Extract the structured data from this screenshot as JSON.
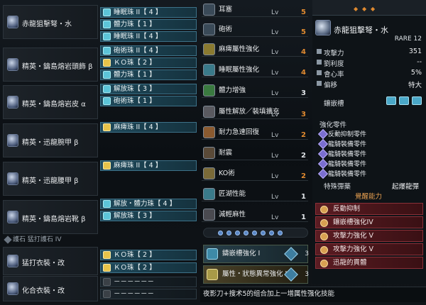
{
  "equipment": [
    {
      "name": "赤龍狙擊弩・水"
    },
    {
      "name": "精英・鑄島熔岩頭飾 β"
    },
    {
      "name": "精英・鑄島熔岩皮 α"
    },
    {
      "name": "精英・迅龍腕甲 β"
    },
    {
      "name": "精英・迅龍腰甲 β"
    },
    {
      "name": "精英・鑄島熔岩靴 β"
    },
    {
      "name": "猛打衣裝・改"
    },
    {
      "name": "化合衣裝・改"
    }
  ],
  "charm": "護石 猛打護石 IV",
  "slots": [
    "睡眠珠 II【 4 】",
    "體力珠【 1 】",
    "睡眠珠 II【 4 】",
    "砲術珠 II【 4 】",
    "ＫＯ珠【 2 】",
    "體力珠【 1 】",
    "解放珠【 3 】",
    "砲術珠【 1 】",
    "麻痺珠 II【 4 】",
    "麻痺珠 II【 4 】",
    "解放・體力珠【 4 】",
    "解放珠【 3 】",
    "ＫＯ珠【 2 】",
    "ＫＯ珠【 2 】",
    "－－－－－－",
    "－－－－－－"
  ],
  "skills": [
    {
      "name": "耳塞",
      "lv": "Lv",
      "num": "5"
    },
    {
      "name": "砲術",
      "lv": "Lv",
      "num": "5"
    },
    {
      "name": "麻痺屬性強化",
      "lv": "Lv",
      "num": "4"
    },
    {
      "name": "睡眠屬性強化",
      "lv": "Lv",
      "num": "4"
    },
    {
      "name": "體力增強",
      "lv": "Lv",
      "num": "3"
    },
    {
      "name": "屬性解放／裝填擴充",
      "lv": "Lv",
      "num": "3"
    },
    {
      "name": "耐力急速回復",
      "lv": "Lv",
      "num": "2"
    },
    {
      "name": "耐震",
      "lv": "Lv",
      "num": "2"
    },
    {
      "name": "KO術",
      "lv": "Lv",
      "num": "2"
    },
    {
      "name": "匠湖性能",
      "lv": "Lv",
      "num": "1"
    },
    {
      "name": "減輕麻性",
      "lv": "Lv",
      "num": "1"
    }
  ],
  "set_bonus": [
    {
      "name": "鑄嵌槽強化 I",
      "count": "3"
    },
    {
      "name": "屬性・狀態異常強化 II",
      "count": "3"
    }
  ],
  "bottom_text": "夜影刀+搜术5的组合加上一增属性强化技能",
  "weapon": {
    "name": "赤龍狙擊弩・水",
    "rarity": "RARE 12",
    "stats": [
      {
        "label": "攻擊力",
        "value": "351"
      },
      {
        "label": "劉利度",
        "value": "--"
      },
      {
        "label": "會心率",
        "value": "5%"
      },
      {
        "label": "偏移",
        "value": "特大"
      }
    ],
    "slot_label": "鑲嵌槽",
    "parts_label": "強化零件",
    "parts": [
      "反動抑制零件",
      "龍騎裝備零件",
      "龍騎裝備零件",
      "龍騎裝備零件",
      "龍騎裝備零件"
    ],
    "special_label": "特殊彈藥",
    "special_value": "起爆龍彈",
    "aug_label": "覺醒能力",
    "augments": [
      "反動抑制",
      "鑲嵌槽強化IV",
      "攻擊力強化 V",
      "攻擊力強化 V",
      "迅龍的貫體"
    ]
  }
}
